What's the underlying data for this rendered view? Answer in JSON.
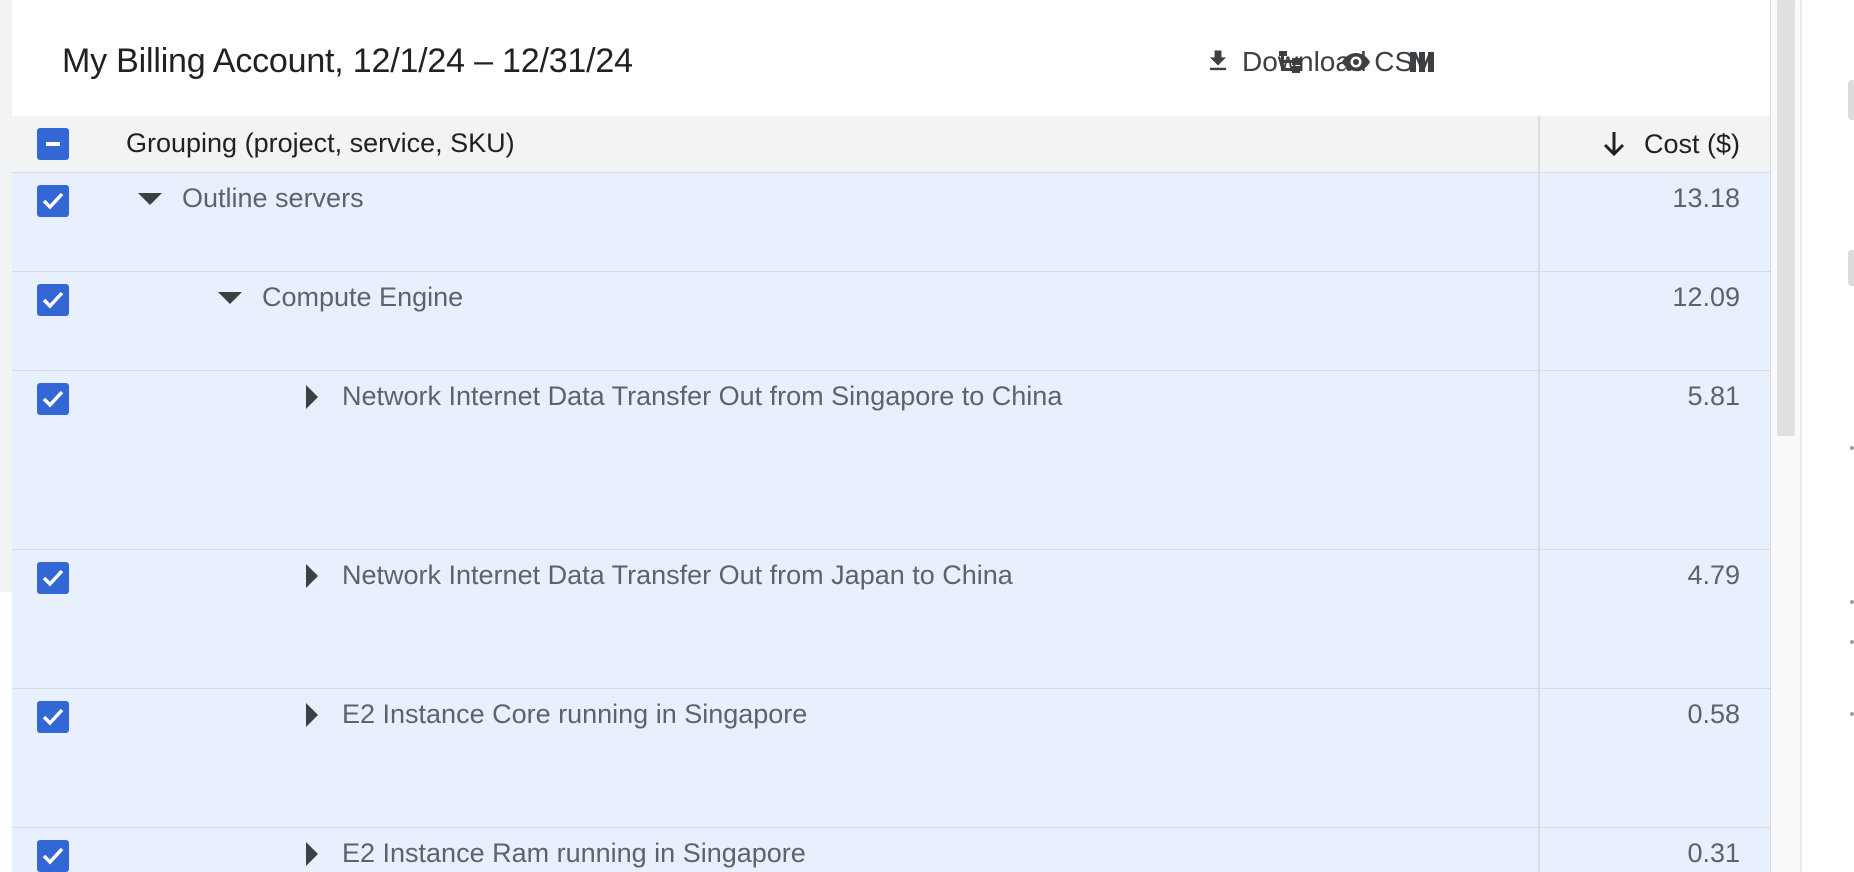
{
  "header": {
    "title": "My Billing Account, 12/1/24 – 12/31/24",
    "download_label": "Download CSV"
  },
  "table": {
    "columns": {
      "grouping": "Grouping (project, service, SKU)",
      "cost": "Cost ($)"
    },
    "rows": [
      {
        "label": "Outline servers",
        "cost": "13.18",
        "level": 0,
        "expanded": true,
        "checked": true
      },
      {
        "label": "Compute Engine",
        "cost": "12.09",
        "level": 1,
        "expanded": true,
        "checked": true
      },
      {
        "label": "Network Internet Data Transfer Out from Singapore to China",
        "cost": "5.81",
        "level": 2,
        "expanded": false,
        "checked": true
      },
      {
        "label": "Network Internet Data Transfer Out from Japan to China",
        "cost": "4.79",
        "level": 2,
        "expanded": false,
        "checked": true
      },
      {
        "label": "E2 Instance Core running in Singapore",
        "cost": "0.58",
        "level": 2,
        "expanded": false,
        "checked": true
      },
      {
        "label": "E2 Instance Ram running in Singapore",
        "cost": "0.31",
        "level": 2,
        "expanded": false,
        "checked": true
      }
    ]
  },
  "colors": {
    "accent": "#3367d6",
    "row_selected_bg": "#e8f0fe",
    "header_bg": "#f1f3f4"
  },
  "icons": {
    "download": "download-icon",
    "group": "group-by-icon",
    "visibility": "eye-icon",
    "columns": "columns-icon",
    "sort": "arrow-down-icon",
    "expand": "expand-triangle-icon"
  }
}
